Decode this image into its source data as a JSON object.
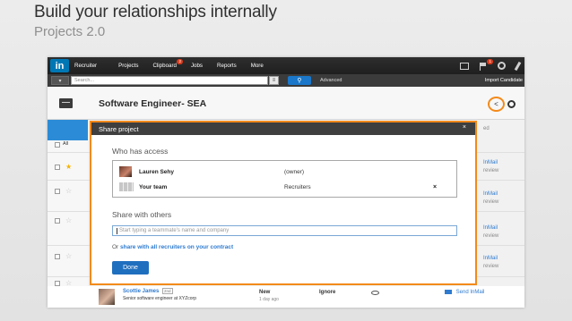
{
  "slide": {
    "title": "Build your relationships internally",
    "subtitle": "Projects 2.0"
  },
  "nav": {
    "logo": "in",
    "items": [
      "Recruiter",
      "Projects",
      "Clipboard",
      "Jobs",
      "Reports",
      "More"
    ],
    "clipboard_badge": "2",
    "flag_badge": "1",
    "icons": [
      "mail-icon",
      "flag-icon",
      "tools-icon",
      "edit-icon"
    ]
  },
  "search": {
    "placeholder": "Search...",
    "advanced_label": "Advanced",
    "import_label": "Import Candidate"
  },
  "project": {
    "title": "Software Engineer- SEA"
  },
  "list": {
    "all_label": "All",
    "right_header": "ed",
    "right_items": [
      "InMail",
      "review",
      "InMail",
      "review",
      "InMail",
      "review",
      "InMail",
      "review"
    ]
  },
  "modal": {
    "title": "Share project",
    "close": "×",
    "who_has_access_label": "Who has access",
    "members": [
      {
        "name": "Lauren Sehy",
        "role": "(owner)"
      },
      {
        "name": "Your team",
        "role": "Recruiters",
        "remove": "×"
      }
    ],
    "share_with_others_label": "Share with others",
    "share_input_placeholder": "Start typing a teammate's name and company",
    "or_prefix": "Or",
    "share_all_link": "share with all recruiters on your contract",
    "done_label": "Done"
  },
  "bottom_row": {
    "name": "Scottie James",
    "degree": "2nd",
    "headline": "Senior software engineer at XYZcorp",
    "status": "New",
    "time_ago": "1 day ago",
    "action": "Ignore",
    "inmail": "Send InMail"
  },
  "colors": {
    "highlight": "#f38a1a",
    "primary_button": "#1f6fbf",
    "link": "#2e7bd0"
  }
}
